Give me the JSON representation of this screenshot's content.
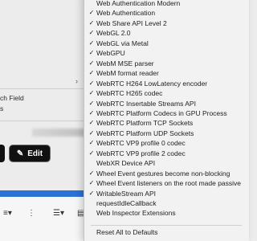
{
  "background": {
    "left_texts": [
      {
        "text": "ch Field"
      },
      {
        "text": "s"
      }
    ],
    "edit_button_label": "Edit",
    "accent_color": "#2b71d8"
  },
  "menu": {
    "items": [
      {
        "label": "Web Authentication Modern",
        "checked": false
      },
      {
        "label": "Web Authentication",
        "checked": true
      },
      {
        "label": "Web Share API Level 2",
        "checked": true
      },
      {
        "label": "WebGL 2.0",
        "checked": true
      },
      {
        "label": "WebGL via Metal",
        "checked": true
      },
      {
        "label": "WebGPU",
        "checked": true
      },
      {
        "label": "WebM MSE parser",
        "checked": true
      },
      {
        "label": "WebM format reader",
        "checked": true
      },
      {
        "label": "WebRTC H264 LowLatency encoder",
        "checked": true
      },
      {
        "label": "WebRTC H265 codec",
        "checked": true
      },
      {
        "label": "WebRTC Insertable Streams API",
        "checked": true
      },
      {
        "label": "WebRTC Platform Codecs in GPU Process",
        "checked": true
      },
      {
        "label": "WebRTC Platform TCP Sockets",
        "checked": true
      },
      {
        "label": "WebRTC Platform UDP Sockets",
        "checked": true
      },
      {
        "label": "WebRTC VP9 profile 0 codec",
        "checked": true
      },
      {
        "label": "WebRTC VP9 profile 2 codec",
        "checked": true
      },
      {
        "label": "WebXR Device API",
        "checked": false
      },
      {
        "label": "Wheel Event gestures become non-blocking",
        "checked": true
      },
      {
        "label": "Wheel Event listeners on the root made passive",
        "checked": true
      },
      {
        "label": "WritableStream API",
        "checked": true
      },
      {
        "label": "requestIdleCallback",
        "checked": false
      },
      {
        "label": "Web Inspector Extensions",
        "checked": false
      }
    ],
    "reset_label": "Reset All to Defaults",
    "check_glyph": "✓"
  }
}
